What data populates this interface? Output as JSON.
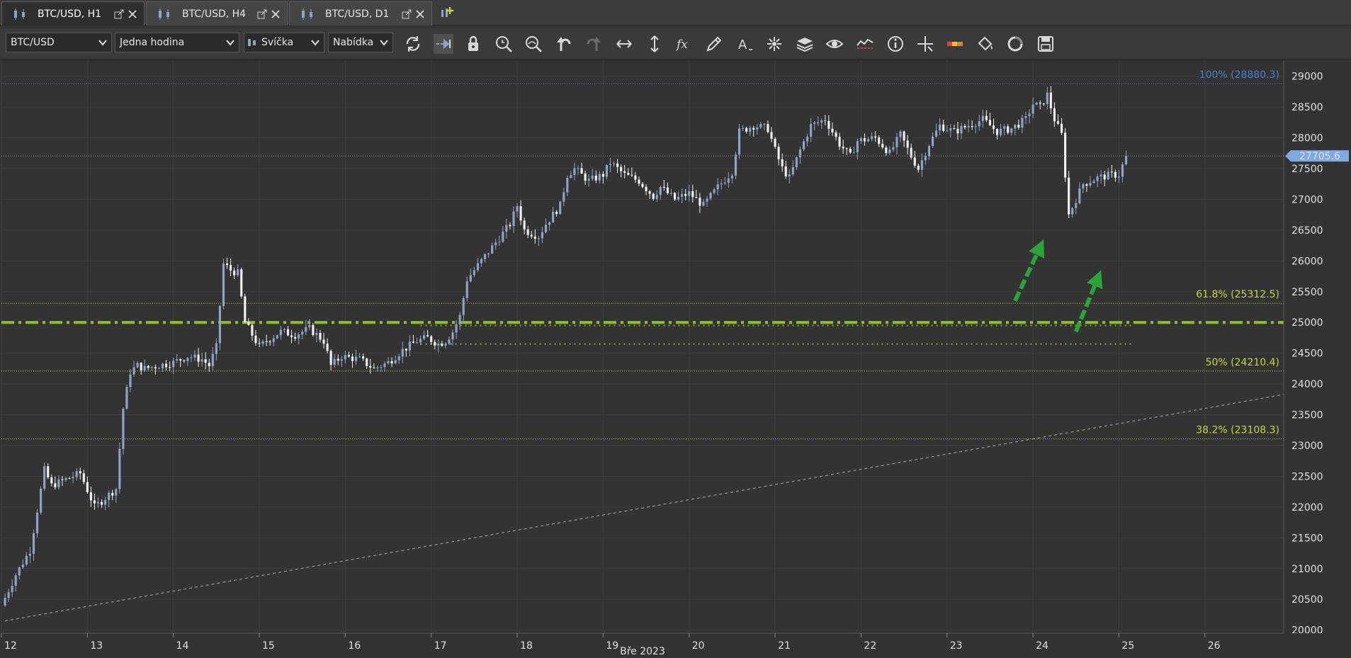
{
  "tabs": [
    {
      "label": "BTC/USD, H1",
      "active": true
    },
    {
      "label": "BTC/USD, H4",
      "active": false
    },
    {
      "label": "BTC/USD, D1",
      "active": false
    }
  ],
  "toolbar": {
    "instrument": "BTC/USD",
    "timeframe": "Jedna hodina",
    "chart_type": "Svíčka",
    "price_side": "Nabídka",
    "icons": [
      "refresh-icon",
      "shift-right-icon",
      "lock-icon",
      "zoom-in-icon",
      "zoom-out-icon",
      "undo-icon",
      "redo-icon",
      "horizontal-resize-icon",
      "vertical-resize-icon",
      "indicator-fx-icon",
      "pencil-draw-icon",
      "text-tool-icon",
      "drawings-tools-icon",
      "layers-icon",
      "eye-icon",
      "signals-icon",
      "info-icon",
      "crosshair-icon",
      "color-scale-icon",
      "paint-bucket-icon",
      "theme-cycle-icon",
      "save-icon"
    ]
  },
  "colors": {
    "background": "#333333",
    "candle_up": "#8ea4c7",
    "candle_down": "#f0f0f0",
    "fib_100": "#4a7fd0",
    "fib_levels": "#c8d63a",
    "support_line": "#8dbf2f",
    "arrows": "#2aa33a",
    "current_price": "#7fa9e0"
  },
  "chart_data": {
    "type": "candlestick",
    "instrument": "BTC/USD",
    "timeframe": "H1",
    "x_axis_label": "Bře 2023",
    "x_ticks": [
      "12",
      "13",
      "14",
      "15",
      "16",
      "17",
      "18",
      "19",
      "20",
      "21",
      "22",
      "23",
      "24",
      "25",
      "26"
    ],
    "y_ticks": [
      20000,
      20500,
      21000,
      21500,
      22000,
      22500,
      23000,
      23500,
      24000,
      24500,
      25000,
      25500,
      26000,
      26500,
      27000,
      27500,
      28000,
      28500,
      29000
    ],
    "ylim": [
      19950,
      29250
    ],
    "xlim": [
      "2023-03-12T00:00",
      "2023-03-26T22:00"
    ],
    "current_price": {
      "label": "27705.6",
      "value": 27705.6
    },
    "fib_levels": [
      {
        "label": "100% (28880.3)",
        "value": 28880.3
      },
      {
        "label": "61.8% (25312.5)",
        "value": 25312.5
      },
      {
        "label": "50% (24210.4)",
        "value": 24210.4
      },
      {
        "label": "38.2% (23108.3)",
        "value": 23108.3
      }
    ],
    "support_level": 25000,
    "support_zone": [
      24650,
      24950
    ],
    "trendline": {
      "from": {
        "t": "2023-03-12T01:00",
        "price": 20150
      },
      "to": {
        "t": "2023-03-26T22:00",
        "price": 23830
      }
    },
    "arrows": [
      {
        "from": {
          "t": "2023-03-23T19:00",
          "price": 25350
        },
        "to": {
          "t": "2023-03-24T03:00",
          "price": 26350
        }
      },
      {
        "from": {
          "t": "2023-03-24T12:00",
          "price": 24850
        },
        "to": {
          "t": "2023-03-24T19:00",
          "price": 25850
        }
      }
    ],
    "price_path": [
      [
        "2023-03-12T00:00",
        20400
      ],
      [
        "2023-03-12T04:00",
        20900
      ],
      [
        "2023-03-12T08:00",
        21300
      ],
      [
        "2023-03-12T12:00",
        22600
      ],
      [
        "2023-03-12T14:00",
        22350
      ],
      [
        "2023-03-12T18:00",
        22450
      ],
      [
        "2023-03-12T22:00",
        22550
      ],
      [
        "2023-03-13T02:00",
        22000
      ],
      [
        "2023-03-13T05:00",
        22150
      ],
      [
        "2023-03-13T08:00",
        22300
      ],
      [
        "2023-03-13T10:00",
        23600
      ],
      [
        "2023-03-13T12:00",
        24200
      ],
      [
        "2023-03-13T14:00",
        24300
      ],
      [
        "2023-03-13T16:00",
        24250
      ],
      [
        "2023-03-13T20:00",
        24300
      ],
      [
        "2023-03-14T00:00",
        24350
      ],
      [
        "2023-03-14T04:00",
        24450
      ],
      [
        "2023-03-14T08:00",
        24400
      ],
      [
        "2023-03-14T10:00",
        24300
      ],
      [
        "2023-03-14T12:00",
        24600
      ],
      [
        "2023-03-14T14:00",
        25950
      ],
      [
        "2023-03-14T16:00",
        25850
      ],
      [
        "2023-03-14T18:00",
        25800
      ],
      [
        "2023-03-14T20:00",
        25000
      ],
      [
        "2023-03-15T00:00",
        24600
      ],
      [
        "2023-03-15T02:00",
        24700
      ],
      [
        "2023-03-15T06:00",
        24850
      ],
      [
        "2023-03-15T10:00",
        24800
      ],
      [
        "2023-03-15T14:00",
        24900
      ],
      [
        "2023-03-15T18:00",
        24700
      ],
      [
        "2023-03-15T20:00",
        24300
      ],
      [
        "2023-03-15T23:00",
        24450
      ],
      [
        "2023-03-16T04:00",
        24400
      ],
      [
        "2023-03-16T08:00",
        24250
      ],
      [
        "2023-03-16T12:00",
        24350
      ],
      [
        "2023-03-16T16:00",
        24550
      ],
      [
        "2023-03-16T20:00",
        24700
      ],
      [
        "2023-03-16T23:00",
        24750
      ],
      [
        "2023-03-17T02:00",
        24650
      ],
      [
        "2023-03-17T04:00",
        24700
      ],
      [
        "2023-03-17T06:00",
        24850
      ],
      [
        "2023-03-17T08:00",
        25100
      ],
      [
        "2023-03-17T10:00",
        25700
      ],
      [
        "2023-03-17T14:00",
        26000
      ],
      [
        "2023-03-17T18:00",
        26300
      ],
      [
        "2023-03-17T22:00",
        26600
      ],
      [
        "2023-03-18T00:00",
        26900
      ],
      [
        "2023-03-18T02:00",
        26500
      ],
      [
        "2023-03-18T06:00",
        26400
      ],
      [
        "2023-03-18T08:00",
        26600
      ],
      [
        "2023-03-18T12:00",
        26900
      ],
      [
        "2023-03-18T14:00",
        27400
      ],
      [
        "2023-03-18T16:00",
        27500
      ],
      [
        "2023-03-18T20:00",
        27300
      ],
      [
        "2023-03-19T00:00",
        27400
      ],
      [
        "2023-03-19T02:00",
        27600
      ],
      [
        "2023-03-19T06:00",
        27400
      ],
      [
        "2023-03-19T10:00",
        27300
      ],
      [
        "2023-03-19T14:00",
        27050
      ],
      [
        "2023-03-19T16:00",
        27200
      ],
      [
        "2023-03-19T20:00",
        27000
      ],
      [
        "2023-03-20T00:00",
        27100
      ],
      [
        "2023-03-20T04:00",
        26900
      ],
      [
        "2023-03-20T08:00",
        27200
      ],
      [
        "2023-03-20T12:00",
        27450
      ],
      [
        "2023-03-20T14:00",
        28100
      ],
      [
        "2023-03-20T18:00",
        28200
      ],
      [
        "2023-03-20T22:00",
        28150
      ],
      [
        "2023-03-21T00:00",
        27800
      ],
      [
        "2023-03-21T02:00",
        27500
      ],
      [
        "2023-03-21T04:00",
        27350
      ],
      [
        "2023-03-21T07:00",
        27800
      ],
      [
        "2023-03-21T10:00",
        28200
      ],
      [
        "2023-03-21T14:00",
        28300
      ],
      [
        "2023-03-21T18:00",
        27900
      ],
      [
        "2023-03-21T21:00",
        27700
      ],
      [
        "2023-03-21T23:00",
        27950
      ],
      [
        "2023-03-22T04:00",
        28000
      ],
      [
        "2023-03-22T08:00",
        27750
      ],
      [
        "2023-03-22T11:00",
        28050
      ],
      [
        "2023-03-22T14:00",
        27700
      ],
      [
        "2023-03-22T16:00",
        27500
      ],
      [
        "2023-03-22T19:00",
        27900
      ],
      [
        "2023-03-22T22:00",
        28200
      ],
      [
        "2023-03-23T02:00",
        28100
      ],
      [
        "2023-03-23T06:00",
        28200
      ],
      [
        "2023-03-23T10:00",
        28300
      ],
      [
        "2023-03-23T14:00",
        28100
      ],
      [
        "2023-03-23T18:00",
        28150
      ],
      [
        "2023-03-23T22:00",
        28300
      ],
      [
        "2023-03-24T00:00",
        28550
      ],
      [
        "2023-03-24T02:00",
        28500
      ],
      [
        "2023-03-24T04:00",
        28700
      ],
      [
        "2023-03-24T06:00",
        28300
      ],
      [
        "2023-03-24T08:00",
        28050
      ],
      [
        "2023-03-24T10:00",
        26750
      ],
      [
        "2023-03-24T12:00",
        27000
      ],
      [
        "2023-03-24T14:00",
        27250
      ],
      [
        "2023-03-24T18:00",
        27350
      ],
      [
        "2023-03-24T22:00",
        27400
      ],
      [
        "2023-03-25T00:00",
        27400
      ],
      [
        "2023-03-25T02:00",
        27705
      ]
    ]
  }
}
